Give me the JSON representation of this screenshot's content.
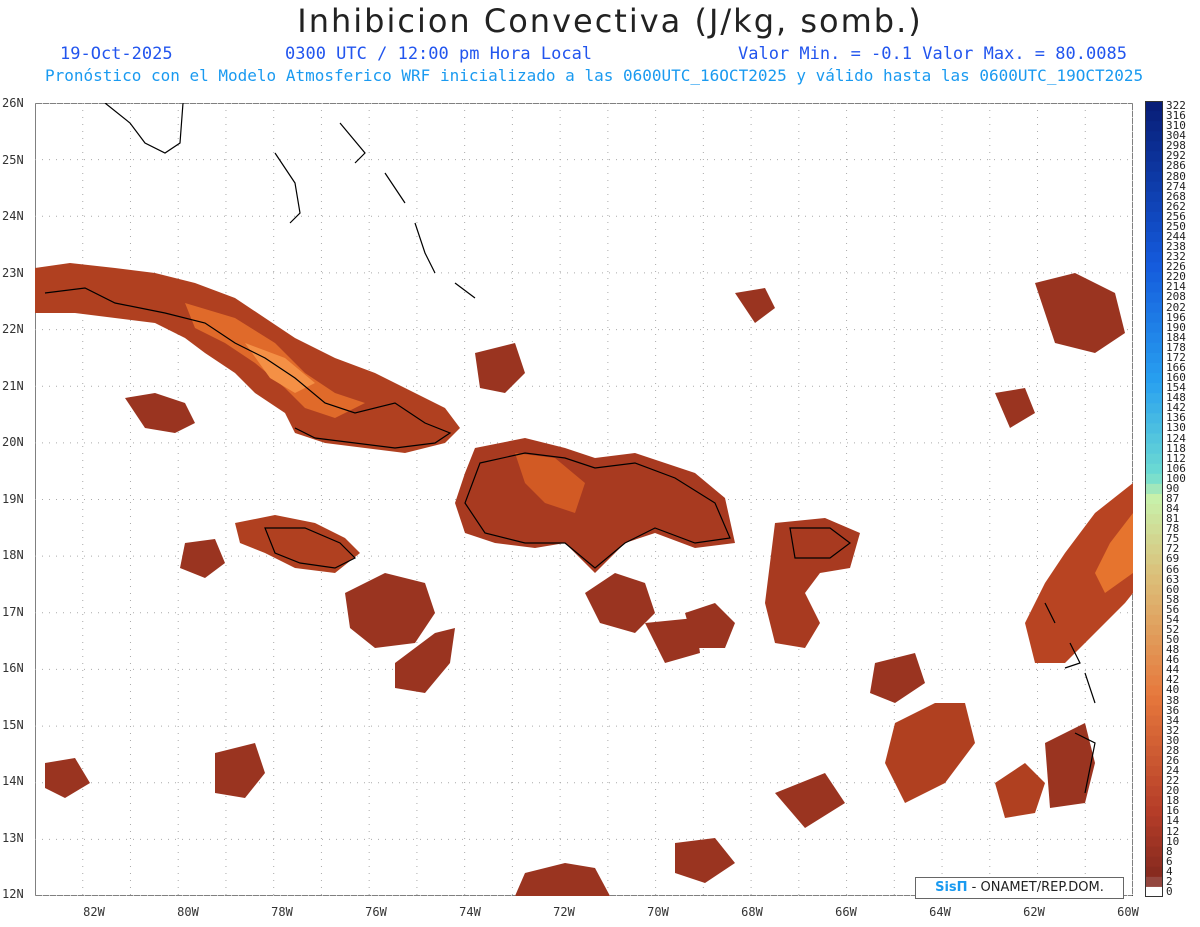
{
  "header": {
    "title": "Inhibicion Convectiva (J/kg, somb.)",
    "date": "19-Oct-2025",
    "time": "0300 UTC / 12:00 pm Hora Local",
    "minmax": "Valor Min. = -0.1  Valor Max. = 80.0085",
    "subtitle": "Pronóstico con el Modelo Atmosferico WRF inicializado a las 0600UTC_16OCT2025 y válido hasta las  0600UTC_19OCT2025"
  },
  "axes": {
    "lat_labels": [
      "26N",
      "25N",
      "24N",
      "23N",
      "22N",
      "21N",
      "20N",
      "19N",
      "18N",
      "17N",
      "16N",
      "15N",
      "14N",
      "13N",
      "12N"
    ],
    "lon_labels": [
      "82W",
      "80W",
      "78W",
      "76W",
      "74W",
      "72W",
      "70W",
      "68W",
      "66W",
      "64W",
      "62W",
      "60W"
    ],
    "lat_range": [
      12,
      26
    ],
    "lon_range": [
      -83,
      -60
    ]
  },
  "colorbar": {
    "labels": [
      "322",
      "316",
      "310",
      "304",
      "298",
      "292",
      "286",
      "280",
      "274",
      "268",
      "262",
      "256",
      "250",
      "244",
      "238",
      "232",
      "226",
      "220",
      "214",
      "208",
      "202",
      "196",
      "190",
      "184",
      "178",
      "172",
      "166",
      "160",
      "154",
      "148",
      "142",
      "136",
      "130",
      "124",
      "118",
      "112",
      "106",
      "100",
      "90",
      "87",
      "84",
      "81",
      "78",
      "75",
      "72",
      "69",
      "66",
      "63",
      "60",
      "58",
      "56",
      "54",
      "52",
      "50",
      "48",
      "46",
      "44",
      "42",
      "40",
      "38",
      "36",
      "34",
      "32",
      "30",
      "28",
      "26",
      "24",
      "22",
      "20",
      "18",
      "16",
      "14",
      "12",
      "10",
      "8",
      "6",
      "4",
      "2",
      "0"
    ]
  },
  "credit": {
    "brand": "SisΠ",
    "text": "- ONAMET/REP.DOM."
  },
  "colors": {
    "field_dark": "#8b2f22",
    "field_mid": "#c8501e",
    "field_light": "#f08030",
    "grid": "#aaaaaa",
    "coast": "#000000"
  }
}
